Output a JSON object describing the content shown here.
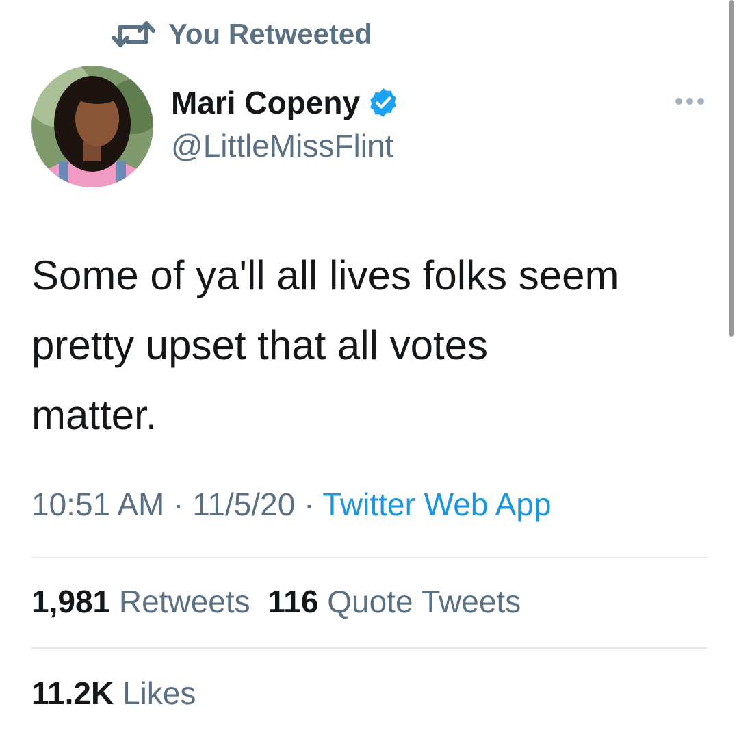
{
  "retweet_header": {
    "label": "You Retweeted",
    "icon": "retweet-icon"
  },
  "author": {
    "name": "Mari Copeny",
    "handle": "@LittleMissFlint",
    "verified": true,
    "verified_color": "#1da1f2"
  },
  "tweet": {
    "text_lines": [
      "Some of ya'll all lives folks seem",
      "pretty upset that all votes",
      "matter."
    ]
  },
  "meta": {
    "time": "10:51 AM",
    "date": "11/5/20",
    "source": "Twitter Web App",
    "separator": " · "
  },
  "stats": {
    "retweets_count": "1,981",
    "retweets_label": "Retweets",
    "quote_count": "116",
    "quote_label": "Quote Tweets",
    "likes_count": "11.2K",
    "likes_label": "Likes"
  },
  "colors": {
    "text": "#14171a",
    "secondary": "#5b7083",
    "link": "#1b95e0",
    "divider": "#e1e8ed"
  }
}
